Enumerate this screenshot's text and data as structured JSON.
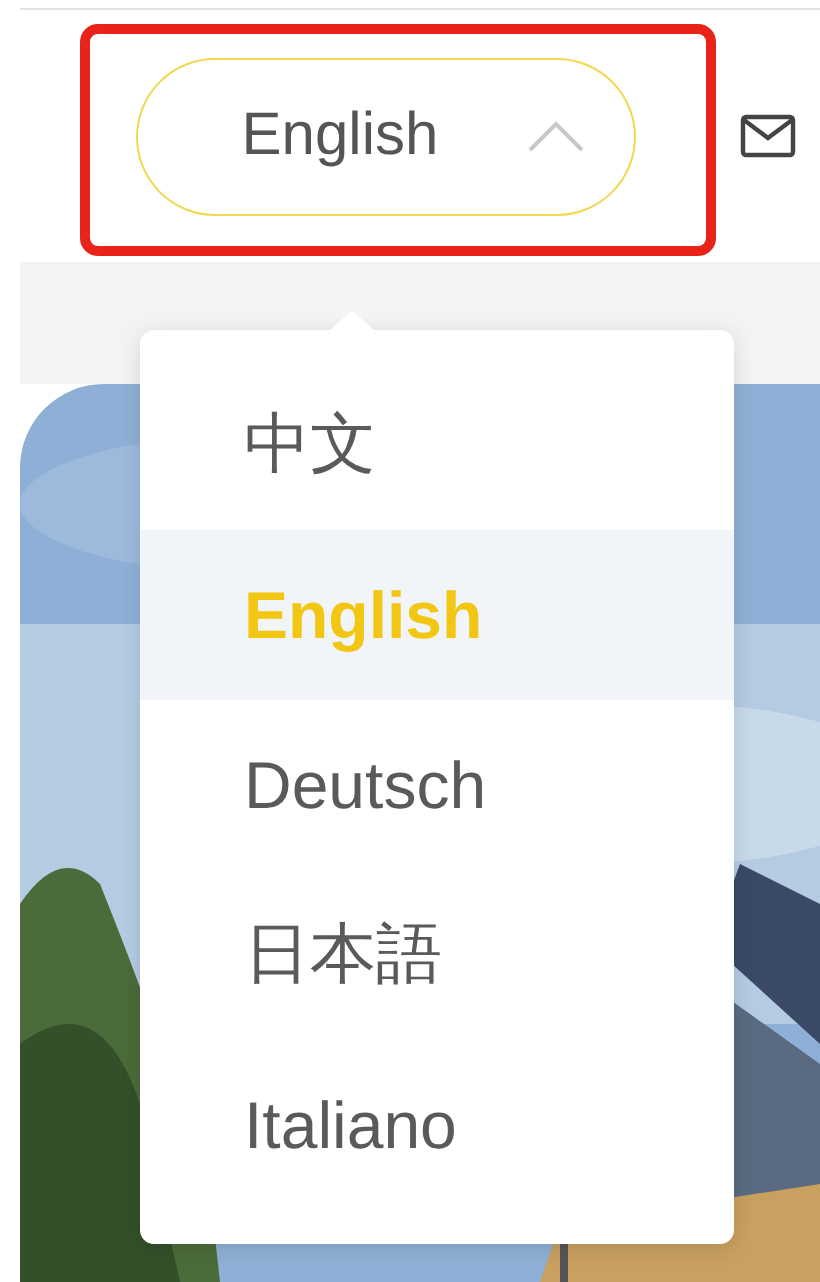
{
  "header": {
    "language_button": {
      "label": "English",
      "expanded": true
    }
  },
  "language_menu": {
    "items": [
      {
        "label": "中文",
        "selected": false
      },
      {
        "label": "English",
        "selected": true
      },
      {
        "label": "Deutsch",
        "selected": false
      },
      {
        "label": "日本語",
        "selected": false
      },
      {
        "label": "Italiano",
        "selected": false
      }
    ]
  }
}
